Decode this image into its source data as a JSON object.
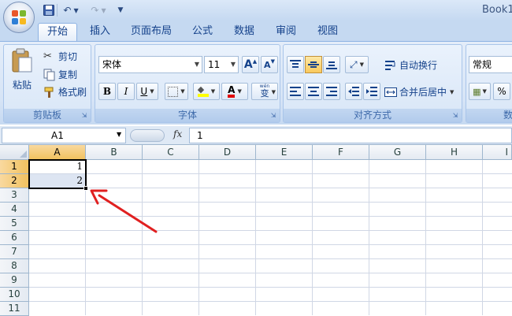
{
  "quick_access": {
    "save_icon": "save-icon",
    "undo_icon": "undo-icon",
    "redo_icon": "redo-icon",
    "customize_symbol": "▼"
  },
  "title": "Book1",
  "tabs": [
    {
      "label": "开始",
      "active": true
    },
    {
      "label": "插入"
    },
    {
      "label": "页面布局"
    },
    {
      "label": "公式"
    },
    {
      "label": "数据"
    },
    {
      "label": "审阅"
    },
    {
      "label": "视图"
    }
  ],
  "ribbon": {
    "clipboard": {
      "label": "剪贴板",
      "paste": "粘贴",
      "cut": "剪切",
      "copy": "复制",
      "format_painter": "格式刷"
    },
    "font": {
      "label": "字体",
      "font_name": "宋体",
      "font_size": "11",
      "grow": "A",
      "shrink": "A",
      "bold": "B",
      "italic": "I",
      "underline": "U",
      "font_color_letter": "A",
      "phonetic": "wén",
      "phonetic_char": "变"
    },
    "alignment": {
      "label": "对齐方式",
      "wrap_text": "自动换行",
      "merge_center": "合并后居中"
    },
    "number": {
      "label": "数",
      "format": "常规",
      "percent": "%"
    }
  },
  "formula_bar": {
    "name_box": "A1",
    "fx": "fx",
    "value": "1"
  },
  "sheet": {
    "columns": [
      "A",
      "B",
      "C",
      "D",
      "E",
      "F",
      "G",
      "H",
      "I"
    ],
    "rows": [
      "1",
      "2",
      "3",
      "4",
      "5",
      "6",
      "7",
      "8",
      "9",
      "10",
      "11"
    ],
    "cells": {
      "A1": "1",
      "A2": "2"
    }
  },
  "colors": {
    "arrow": "#e02020",
    "ribbon": "#dbe7f6",
    "selection_header": "#f5cd7c"
  }
}
